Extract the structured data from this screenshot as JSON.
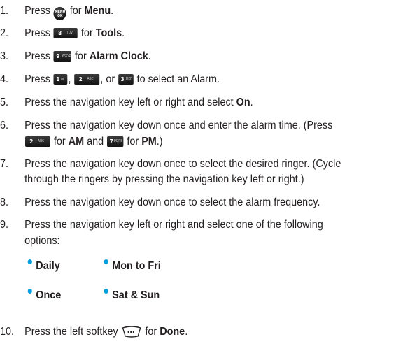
{
  "steps": [
    {
      "num": "1.",
      "a": "Press",
      "b": "for",
      "bold": "Menu",
      "end": ".",
      "key": {
        "label1": "MENU",
        "label2": "OK"
      }
    },
    {
      "num": "2.",
      "a": "Press",
      "b": "for",
      "bold": "Tools",
      "end": ".",
      "key": {
        "n": "8",
        "s": "TUV"
      }
    },
    {
      "num": "3.",
      "a": "Press",
      "b": "for",
      "bold": "Alarm Clock",
      "end": ".",
      "key": {
        "n": "9",
        "s": "WXYZ"
      }
    },
    {
      "num": "4.",
      "a": "Press",
      "sep1": ",",
      "sep2": ", or",
      "rest": "to select an Alarm.",
      "keys": [
        {
          "n": "1",
          "s": "✉"
        },
        {
          "n": "2",
          "s": "ABC"
        },
        {
          "n": "3",
          "s": "DEF"
        }
      ]
    },
    {
      "num": "5.",
      "text": "Press the navigation key left or right and select",
      "bold": "On",
      "end": "."
    },
    {
      "num": "6.",
      "text": "Press the navigation key down once and enter the alarm time. (Press",
      "l2b": "for",
      "l2bold1": "AM",
      "l2and": "and",
      "l2for": "for",
      "l2bold2": "PM",
      "l2end": ".)",
      "key1": {
        "n": "2",
        "s": "ABC"
      },
      "key2": {
        "n": "7",
        "s": "PQRS"
      }
    },
    {
      "num": "7.",
      "line1": "Press the navigation key down once to select the desired ringer. (Cycle",
      "line2": "through the ringers by pressing the navigation key left or right.)"
    },
    {
      "num": "8.",
      "text": "Press the navigation key down once to select the alarm frequency."
    },
    {
      "num": "9.",
      "line1": "Press the navigation key left or right and select one of the following",
      "line2": "options:"
    },
    {
      "num": "10.",
      "a": "Press the left softkey",
      "b": "for",
      "bold": "Done",
      "end": "."
    }
  ],
  "options": [
    "Daily",
    "Mon to Fri",
    "Once",
    "Sat & Sun"
  ],
  "colors": {
    "text": "#231f20",
    "bullet": "#00a0df",
    "key": "#1a1a1a"
  }
}
